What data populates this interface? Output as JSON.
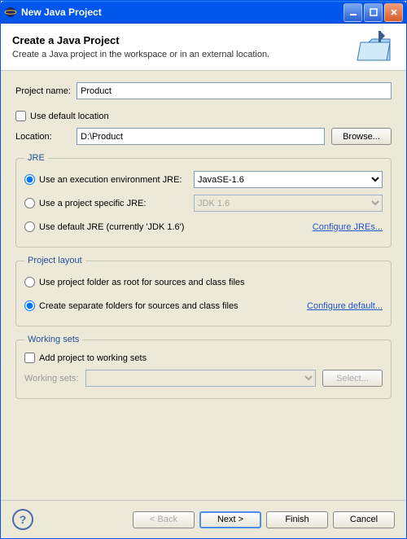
{
  "window": {
    "title": "New Java Project"
  },
  "header": {
    "title": "Create a Java Project",
    "subtitle": "Create a Java project in the workspace or in an external location."
  },
  "project": {
    "name_label": "Project name:",
    "name_value": "Product"
  },
  "location": {
    "use_default_label": "Use default location",
    "use_default_checked": false,
    "label": "Location:",
    "value": "D:\\Product",
    "browse": "Browse..."
  },
  "jre": {
    "legend": "JRE",
    "opt_exec_env": "Use an execution environment JRE:",
    "exec_env_value": "JavaSE-1.6",
    "opt_project_specific": "Use a project specific JRE:",
    "project_specific_value": "JDK 1.6",
    "opt_default": "Use default JRE (currently 'JDK 1.6')",
    "configure": "Configure JREs..."
  },
  "layout": {
    "legend": "Project layout",
    "opt_root": "Use project folder as root for sources and class files",
    "opt_separate": "Create separate folders for sources and class files",
    "configure": "Configure default..."
  },
  "working_sets": {
    "legend": "Working sets",
    "add_label": "Add project to working sets",
    "sets_label": "Working sets:",
    "select": "Select..."
  },
  "footer": {
    "back": "< Back",
    "next": "Next >",
    "finish": "Finish",
    "cancel": "Cancel"
  }
}
